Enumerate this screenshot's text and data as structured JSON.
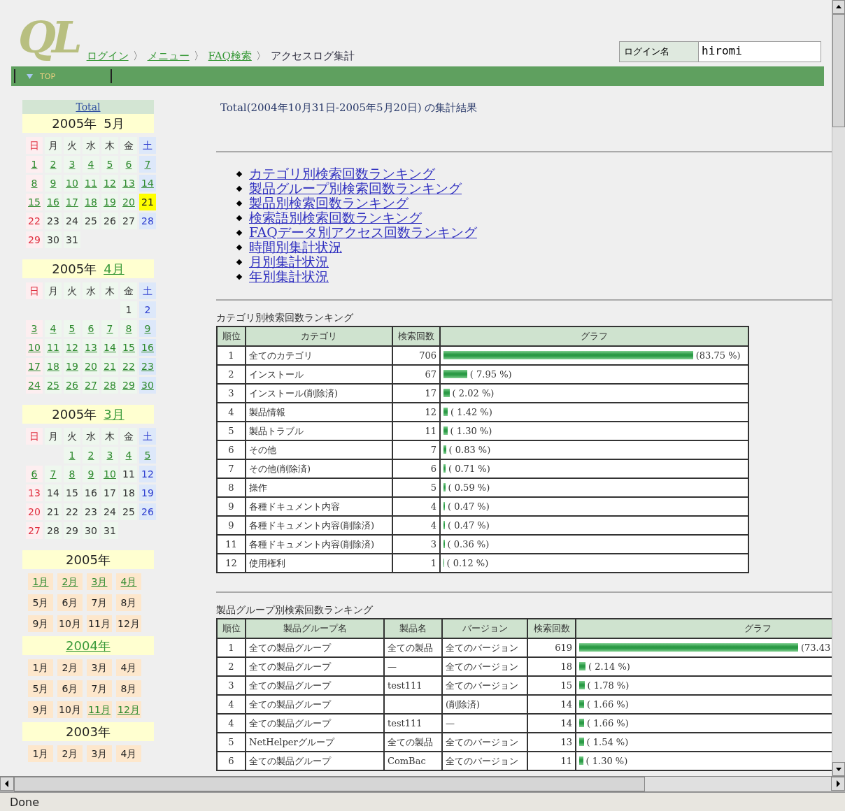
{
  "logo": "QL",
  "breadcrumb": {
    "separator": "〉",
    "items": [
      {
        "label": "ログイン",
        "link": true
      },
      {
        "label": "メニュー",
        "link": true
      },
      {
        "label": "FAQ検索",
        "link": true
      },
      {
        "label": "アクセスログ集計",
        "link": false
      }
    ]
  },
  "login": {
    "label": "ログイン名",
    "value": "hiromi"
  },
  "nav": {
    "label": "TOP"
  },
  "sidebar": {
    "total_link": "Total",
    "calendars": [
      {
        "year": "2005年",
        "month": "5月",
        "month_link": false,
        "weekdays": [
          "日",
          "月",
          "火",
          "水",
          "木",
          "金",
          "土"
        ],
        "weeks": [
          [
            {
              "kind": "day",
              "n": "1",
              "link": true,
              "today": false
            },
            {
              "kind": "day",
              "n": "2",
              "link": true,
              "today": false
            },
            {
              "kind": "day",
              "n": "3",
              "link": true,
              "today": false
            },
            {
              "kind": "day",
              "n": "4",
              "link": true,
              "today": false
            },
            {
              "kind": "day",
              "n": "5",
              "link": true,
              "today": false
            },
            {
              "kind": "day",
              "n": "6",
              "link": true,
              "today": false
            },
            {
              "kind": "day",
              "n": "7",
              "link": true,
              "today": false
            }
          ],
          [
            {
              "kind": "day",
              "n": "8",
              "link": true,
              "today": false
            },
            {
              "kind": "day",
              "n": "9",
              "link": true,
              "today": false
            },
            {
              "kind": "day",
              "n": "10",
              "link": true,
              "today": false
            },
            {
              "kind": "day",
              "n": "11",
              "link": true,
              "today": false
            },
            {
              "kind": "day",
              "n": "12",
              "link": true,
              "today": false
            },
            {
              "kind": "day",
              "n": "13",
              "link": true,
              "today": false
            },
            {
              "kind": "day",
              "n": "14",
              "link": true,
              "today": false
            }
          ],
          [
            {
              "kind": "day",
              "n": "15",
              "link": true,
              "today": false
            },
            {
              "kind": "day",
              "n": "16",
              "link": true,
              "today": false
            },
            {
              "kind": "day",
              "n": "17",
              "link": true,
              "today": false
            },
            {
              "kind": "day",
              "n": "18",
              "link": true,
              "today": false
            },
            {
              "kind": "day",
              "n": "19",
              "link": true,
              "today": false
            },
            {
              "kind": "day",
              "n": "20",
              "link": true,
              "today": false
            },
            {
              "kind": "day",
              "n": "21",
              "link": false,
              "today": true
            }
          ],
          [
            {
              "kind": "day",
              "n": "22",
              "link": false,
              "today": false
            },
            {
              "kind": "day",
              "n": "23",
              "link": false,
              "today": false
            },
            {
              "kind": "day",
              "n": "24",
              "link": false,
              "today": false
            },
            {
              "kind": "day",
              "n": "25",
              "link": false,
              "today": false
            },
            {
              "kind": "day",
              "n": "26",
              "link": false,
              "today": false
            },
            {
              "kind": "day",
              "n": "27",
              "link": false,
              "today": false
            },
            {
              "kind": "day",
              "n": "28",
              "link": false,
              "today": false
            }
          ],
          [
            {
              "kind": "day",
              "n": "29",
              "link": false,
              "today": false
            },
            {
              "kind": "day",
              "n": "30",
              "link": false,
              "today": false
            },
            {
              "kind": "day",
              "n": "31",
              "link": false,
              "today": false
            },
            {
              "kind": "blank"
            },
            {
              "kind": "blank"
            },
            {
              "kind": "blank"
            },
            {
              "kind": "blank"
            }
          ]
        ]
      },
      {
        "year": "2005年",
        "month": "4月",
        "month_link": true,
        "weekdays": [
          "日",
          "月",
          "火",
          "水",
          "木",
          "金",
          "土"
        ],
        "weeks": [
          [
            {
              "kind": "blank"
            },
            {
              "kind": "blank"
            },
            {
              "kind": "blank"
            },
            {
              "kind": "blank"
            },
            {
              "kind": "blank"
            },
            {
              "kind": "day",
              "n": "1",
              "link": false,
              "today": false
            },
            {
              "kind": "day",
              "n": "2",
              "link": false,
              "today": false
            }
          ],
          [
            {
              "kind": "day",
              "n": "3",
              "link": true,
              "today": false
            },
            {
              "kind": "day",
              "n": "4",
              "link": true,
              "today": false
            },
            {
              "kind": "day",
              "n": "5",
              "link": true,
              "today": false
            },
            {
              "kind": "day",
              "n": "6",
              "link": true,
              "today": false
            },
            {
              "kind": "day",
              "n": "7",
              "link": true,
              "today": false
            },
            {
              "kind": "day",
              "n": "8",
              "link": true,
              "today": false
            },
            {
              "kind": "day",
              "n": "9",
              "link": true,
              "today": false
            }
          ],
          [
            {
              "kind": "day",
              "n": "10",
              "link": true,
              "today": false
            },
            {
              "kind": "day",
              "n": "11",
              "link": true,
              "today": false
            },
            {
              "kind": "day",
              "n": "12",
              "link": true,
              "today": false
            },
            {
              "kind": "day",
              "n": "13",
              "link": true,
              "today": false
            },
            {
              "kind": "day",
              "n": "14",
              "link": true,
              "today": false
            },
            {
              "kind": "day",
              "n": "15",
              "link": true,
              "today": false
            },
            {
              "kind": "day",
              "n": "16",
              "link": true,
              "today": false
            }
          ],
          [
            {
              "kind": "day",
              "n": "17",
              "link": true,
              "today": false
            },
            {
              "kind": "day",
              "n": "18",
              "link": true,
              "today": false
            },
            {
              "kind": "day",
              "n": "19",
              "link": true,
              "today": false
            },
            {
              "kind": "day",
              "n": "20",
              "link": true,
              "today": false
            },
            {
              "kind": "day",
              "n": "21",
              "link": true,
              "today": false
            },
            {
              "kind": "day",
              "n": "22",
              "link": true,
              "today": false
            },
            {
              "kind": "day",
              "n": "23",
              "link": true,
              "today": false
            }
          ],
          [
            {
              "kind": "day",
              "n": "24",
              "link": true,
              "today": false
            },
            {
              "kind": "day",
              "n": "25",
              "link": true,
              "today": false
            },
            {
              "kind": "day",
              "n": "26",
              "link": true,
              "today": false
            },
            {
              "kind": "day",
              "n": "27",
              "link": true,
              "today": false
            },
            {
              "kind": "day",
              "n": "28",
              "link": true,
              "today": false
            },
            {
              "kind": "day",
              "n": "29",
              "link": true,
              "today": false
            },
            {
              "kind": "day",
              "n": "30",
              "link": true,
              "today": false
            }
          ]
        ]
      },
      {
        "year": "2005年",
        "month": "3月",
        "month_link": true,
        "weekdays": [
          "日",
          "月",
          "火",
          "水",
          "木",
          "金",
          "土"
        ],
        "weeks": [
          [
            {
              "kind": "blank"
            },
            {
              "kind": "blank"
            },
            {
              "kind": "day",
              "n": "1",
              "link": true,
              "today": false
            },
            {
              "kind": "day",
              "n": "2",
              "link": true,
              "today": false
            },
            {
              "kind": "day",
              "n": "3",
              "link": true,
              "today": false
            },
            {
              "kind": "day",
              "n": "4",
              "link": true,
              "today": false
            },
            {
              "kind": "day",
              "n": "5",
              "link": true,
              "today": false
            }
          ],
          [
            {
              "kind": "day",
              "n": "6",
              "link": true,
              "today": false
            },
            {
              "kind": "day",
              "n": "7",
              "link": true,
              "today": false
            },
            {
              "kind": "day",
              "n": "8",
              "link": true,
              "today": false
            },
            {
              "kind": "day",
              "n": "9",
              "link": true,
              "today": false
            },
            {
              "kind": "day",
              "n": "10",
              "link": true,
              "today": false
            },
            {
              "kind": "day",
              "n": "11",
              "link": false,
              "today": false
            },
            {
              "kind": "day",
              "n": "12",
              "link": false,
              "today": false
            }
          ],
          [
            {
              "kind": "day",
              "n": "13",
              "link": false,
              "today": false
            },
            {
              "kind": "day",
              "n": "14",
              "link": false,
              "today": false
            },
            {
              "kind": "day",
              "n": "15",
              "link": false,
              "today": false
            },
            {
              "kind": "day",
              "n": "16",
              "link": false,
              "today": false
            },
            {
              "kind": "day",
              "n": "17",
              "link": false,
              "today": false
            },
            {
              "kind": "day",
              "n": "18",
              "link": false,
              "today": false
            },
            {
              "kind": "day",
              "n": "19",
              "link": false,
              "today": false
            }
          ],
          [
            {
              "kind": "day",
              "n": "20",
              "link": false,
              "today": false
            },
            {
              "kind": "day",
              "n": "21",
              "link": false,
              "today": false
            },
            {
              "kind": "day",
              "n": "22",
              "link": false,
              "today": false
            },
            {
              "kind": "day",
              "n": "23",
              "link": false,
              "today": false
            },
            {
              "kind": "day",
              "n": "24",
              "link": false,
              "today": false
            },
            {
              "kind": "day",
              "n": "25",
              "link": false,
              "today": false
            },
            {
              "kind": "day",
              "n": "26",
              "link": false,
              "today": false
            }
          ],
          [
            {
              "kind": "day",
              "n": "27",
              "link": false,
              "today": false
            },
            {
              "kind": "day",
              "n": "28",
              "link": false,
              "today": false
            },
            {
              "kind": "day",
              "n": "29",
              "link": false,
              "today": false
            },
            {
              "kind": "day",
              "n": "30",
              "link": false,
              "today": false
            },
            {
              "kind": "day",
              "n": "31",
              "link": false,
              "today": false
            },
            {
              "kind": "blank"
            },
            {
              "kind": "blank"
            }
          ]
        ]
      }
    ],
    "years": [
      {
        "year": "2005年",
        "year_link": false,
        "months": [
          {
            "label": "1月",
            "link": true
          },
          {
            "label": "2月",
            "link": true
          },
          {
            "label": "3月",
            "link": true
          },
          {
            "label": "4月",
            "link": true
          },
          {
            "label": "5月",
            "link": false
          },
          {
            "label": "6月",
            "link": false
          },
          {
            "label": "7月",
            "link": false
          },
          {
            "label": "8月",
            "link": false
          },
          {
            "label": "9月",
            "link": false
          },
          {
            "label": "10月",
            "link": false
          },
          {
            "label": "11月",
            "link": false
          },
          {
            "label": "12月",
            "link": false
          }
        ]
      },
      {
        "year": "2004年",
        "year_link": true,
        "months": [
          {
            "label": "1月",
            "link": false
          },
          {
            "label": "2月",
            "link": false
          },
          {
            "label": "3月",
            "link": false
          },
          {
            "label": "4月",
            "link": false
          },
          {
            "label": "5月",
            "link": false
          },
          {
            "label": "6月",
            "link": false
          },
          {
            "label": "7月",
            "link": false
          },
          {
            "label": "8月",
            "link": false
          },
          {
            "label": "9月",
            "link": false
          },
          {
            "label": "10月",
            "link": false
          },
          {
            "label": "11月",
            "link": true
          },
          {
            "label": "12月",
            "link": true
          }
        ]
      },
      {
        "year": "2003年",
        "year_link": false,
        "months": [
          {
            "label": "1月",
            "link": false
          },
          {
            "label": "2月",
            "link": false
          },
          {
            "label": "3月",
            "link": false
          },
          {
            "label": "4月",
            "link": false
          }
        ]
      }
    ]
  },
  "main": {
    "title": "Total(2004年10月31日-2005年5月20日) の集計結果",
    "links": [
      "カテゴリ別検索回数ランキング",
      "製品グループ別検索回数ランキング",
      "製品別検索回数ランキング",
      "検索語別検索回数ランキング",
      "FAQデータ別アクセス回数ランキング",
      "時間別集計状況",
      "月別集計状況",
      "年別集計状況"
    ],
    "rankings": [
      {
        "title": "カテゴリ別検索回数ランキング",
        "columns": [
          "順位",
          "カテゴリ",
          "検索回数",
          "グラフ"
        ],
        "rows": [
          {
            "cells": [
              "1",
              "全てのカテゴリ",
              "706"
            ],
            "percent": "(83.75 %)",
            "level": 0.8375
          },
          {
            "cells": [
              "2",
              "インストール",
              "67"
            ],
            "percent": "( 7.95 %)",
            "level": 0.0795
          },
          {
            "cells": [
              "3",
              "インストール(削除済)",
              "17"
            ],
            "percent": "( 2.02 %)",
            "level": 0.0202
          },
          {
            "cells": [
              "4",
              "製品情報",
              "12"
            ],
            "percent": "( 1.42 %)",
            "level": 0.0142
          },
          {
            "cells": [
              "5",
              "製品トラブル",
              "11"
            ],
            "percent": "( 1.30 %)",
            "level": 0.013
          },
          {
            "cells": [
              "6",
              "その他",
              "7"
            ],
            "percent": "( 0.83 %)",
            "level": 0.0083
          },
          {
            "cells": [
              "7",
              "その他(削除済)",
              "6"
            ],
            "percent": "( 0.71 %)",
            "level": 0.0071
          },
          {
            "cells": [
              "8",
              "操作",
              "5"
            ],
            "percent": "( 0.59 %)",
            "level": 0.0059
          },
          {
            "cells": [
              "9",
              "各種ドキュメント内容",
              "4"
            ],
            "percent": "( 0.47 %)",
            "level": 0.0047
          },
          {
            "cells": [
              "9",
              "各種ドキュメント内容(削除済)",
              "4"
            ],
            "percent": "( 0.47 %)",
            "level": 0.0047
          },
          {
            "cells": [
              "11",
              "各種ドキュメント内容(削除済)",
              "3"
            ],
            "percent": "( 0.36 %)",
            "level": 0.0036
          },
          {
            "cells": [
              "12",
              "使用権利",
              "1"
            ],
            "percent": "( 0.12 %)",
            "level": 0.0012
          }
        ]
      },
      {
        "title": "製品グループ別検索回数ランキング",
        "columns": [
          "順位",
          "製品グループ名",
          "製品名",
          "バージョン",
          "検索回数",
          "グラフ"
        ],
        "rows": [
          {
            "cells": [
              "1",
              "全ての製品グループ",
              "全ての製品",
              "全てのバージョン",
              "619"
            ],
            "percent": "(73.43"
          },
          {
            "cells": [
              "2",
              "全ての製品グループ",
              "—",
              "全てのバージョン",
              "18"
            ],
            "percent": "( 2.14 %)",
            "level": 0.0214
          },
          {
            "cells": [
              "3",
              "全ての製品グループ",
              "test111",
              "全てのバージョン",
              "15"
            ],
            "percent": "( 1.78 %)",
            "level": 0.0178
          },
          {
            "cells": [
              "4",
              "全ての製品グループ",
              "",
              "(削除済)",
              "14"
            ],
            "percent": "( 1.66 %)",
            "level": 0.0166
          },
          {
            "cells": [
              "4",
              "全ての製品グループ",
              "test111",
              "—",
              "14"
            ],
            "percent": "( 1.66 %)",
            "level": 0.0166
          },
          {
            "cells": [
              "5",
              "NetHelperグループ",
              "全ての製品",
              "全てのバージョン",
              "13"
            ],
            "percent": "( 1.54 %)",
            "level": 0.0154
          },
          {
            "cells": [
              "6",
              "全ての製品グループ",
              "ComBac",
              "全てのバージョン",
              "11"
            ],
            "percent": "( 1.30 %)",
            "level": 0.013
          }
        ]
      }
    ]
  },
  "status_bar": "Done"
}
